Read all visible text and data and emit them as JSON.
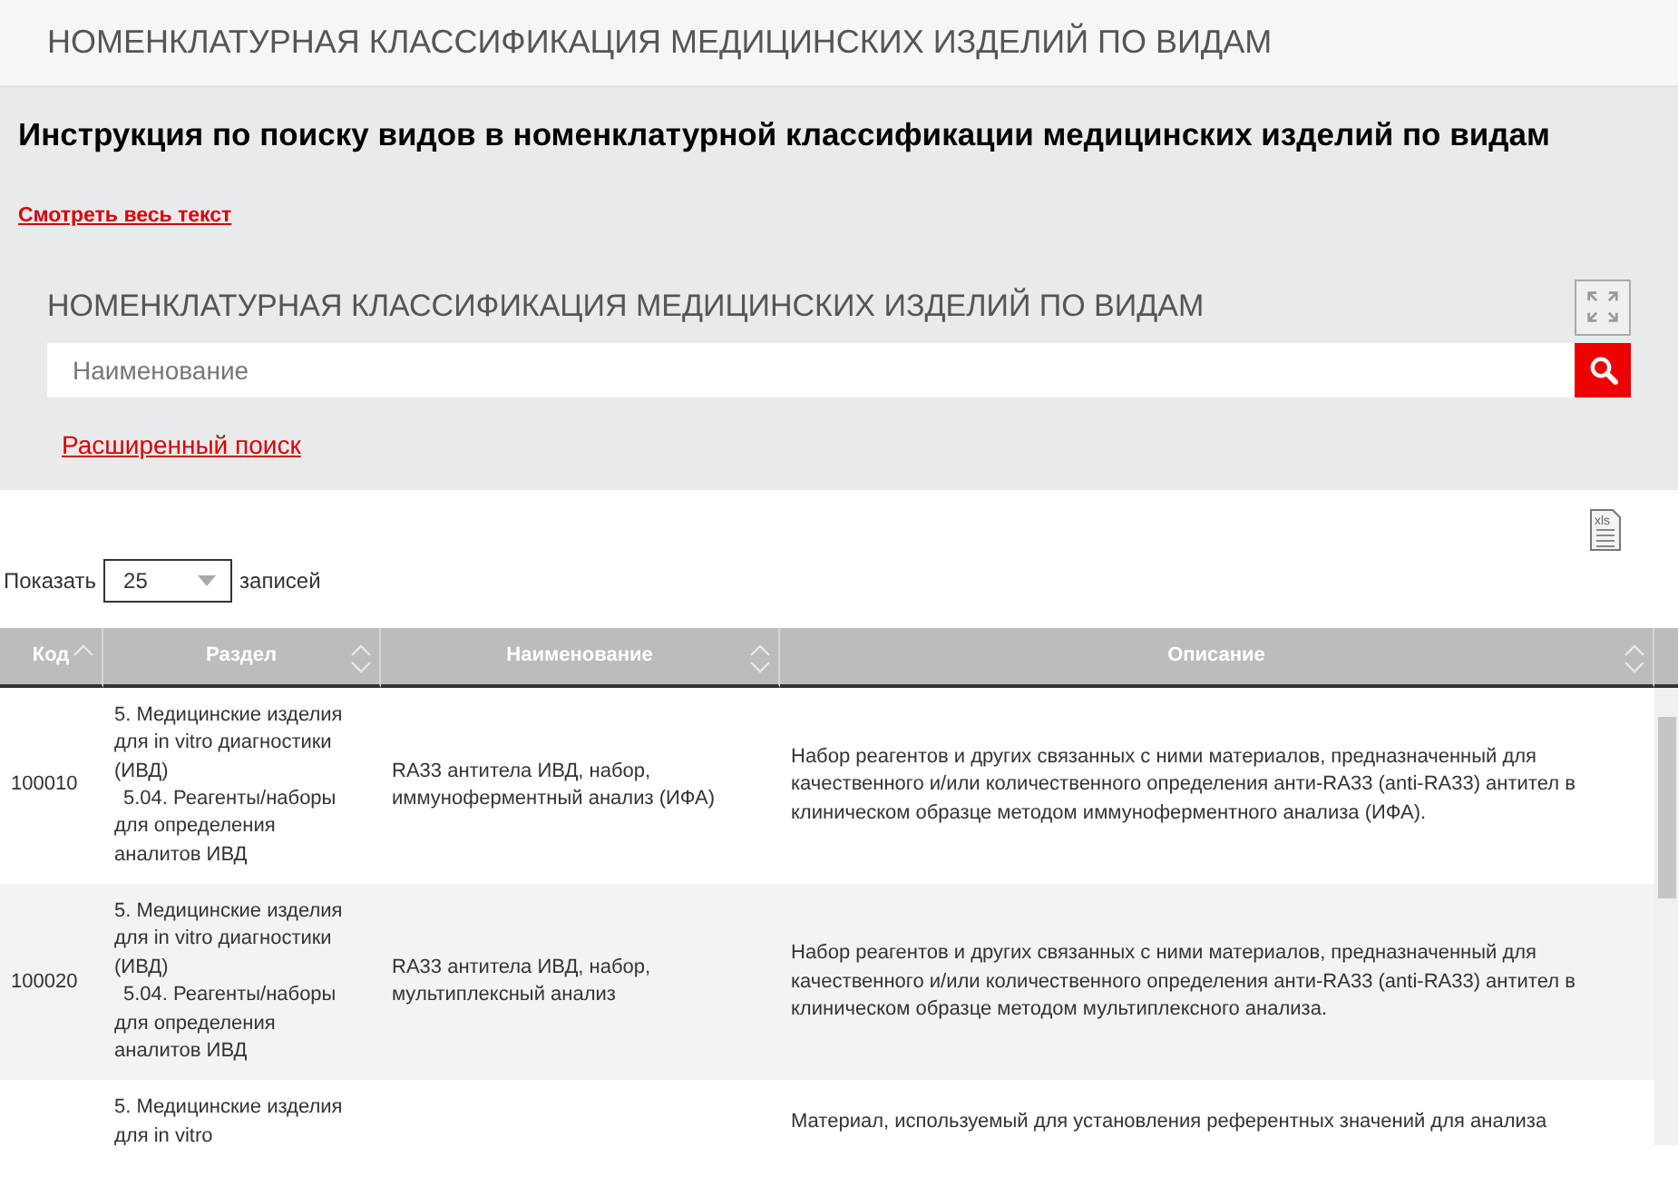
{
  "page_title": "НОМЕНКЛАТУРНАЯ КЛАССИФИКАЦИЯ МЕДИЦИНСКИХ ИЗДЕЛИЙ ПО ВИДАМ",
  "instructions": {
    "title": "Инструкция по поиску видов в номенклатурной классификации медицинских изделий по видам",
    "link": "Смотреть весь текст"
  },
  "search": {
    "title": "НОМЕНКЛАТУРНАЯ КЛАССИФИКАЦИЯ МЕДИЦИНСКИХ ИЗДЕЛИЙ ПО ВИДАМ",
    "placeholder": "Наименование",
    "advanced_link": "Расширенный поиск"
  },
  "export_icon_text": "xls",
  "length_menu": {
    "prefix": "Показать",
    "value": "25",
    "suffix": "записей"
  },
  "table": {
    "columns": [
      {
        "label": "Код",
        "sorted": true
      },
      {
        "label": "Раздел",
        "sorted": false
      },
      {
        "label": "Наименование",
        "sorted": false
      },
      {
        "label": "Описание",
        "sorted": false
      }
    ],
    "rows": [
      {
        "code": "100010",
        "section": [
          "5. Медицинские изделия для in vitro диагностики (ИВД)",
          "5.04. Реагенты/наборы для определения аналитов ИВД"
        ],
        "name": "RA33 антитела ИВД, набор, иммуноферментный анализ (ИФА)",
        "description": "Набор реагентов и других связанных с ними материалов, предназначенный для качественного и/или количественного определения анти-RA33 (anti-RA33) антител в клиническом образце методом иммуноферментного анализа (ИФА)."
      },
      {
        "code": "100020",
        "section": [
          "5. Медицинские изделия для in vitro диагностики (ИВД)",
          "5.04. Реагенты/наборы для определения аналитов ИВД"
        ],
        "name": "RA33 антитела ИВД, набор, мультиплексный анализ",
        "description": "Набор реагентов и других связанных с ними материалов, предназначенный для качественного и/или количественного определения анти-RA33 (anti-RA33) антител в клиническом образце методом мультиплексного анализа."
      },
      {
        "code": "",
        "section": [
          "5. Медицинские изделия для in vitro"
        ],
        "name": "",
        "description": "Материал, используемый для установления референтных значений для анализа"
      }
    ]
  }
}
